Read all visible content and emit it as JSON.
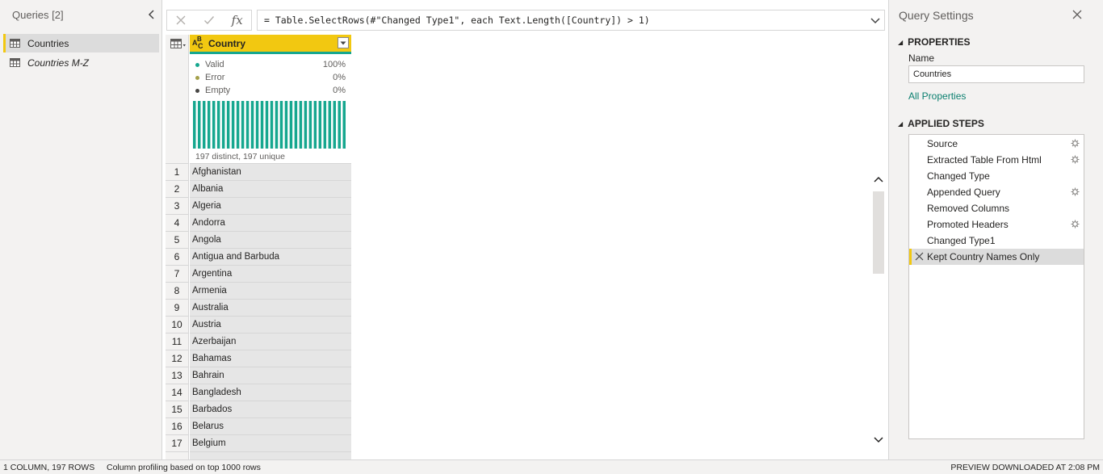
{
  "queries": {
    "header": "Queries [2]",
    "items": [
      {
        "label": "Countries",
        "active": true
      },
      {
        "label": "Countries M-Z",
        "active": false
      }
    ]
  },
  "formula": {
    "text": "= Table.SelectRows(#\"Changed Type1\", each Text.Length([Country]) > 1)",
    "fx_label": "fx"
  },
  "grid": {
    "column": {
      "name": "Country",
      "type_icon": "abc-text-type-icon"
    },
    "profile": {
      "valid_label": "Valid",
      "valid_value": "100%",
      "error_label": "Error",
      "error_value": "0%",
      "empty_label": "Empty",
      "empty_value": "0%",
      "distinct_text": "197 distinct, 197 unique",
      "valid_fraction": 1.0,
      "colors": {
        "valid": "#16a78f",
        "error": "#a4a04a",
        "empty": "#484644"
      }
    },
    "rows": [
      {
        "num": "1",
        "value": "Afghanistan"
      },
      {
        "num": "2",
        "value": "Albania"
      },
      {
        "num": "3",
        "value": "Algeria"
      },
      {
        "num": "4",
        "value": "Andorra"
      },
      {
        "num": "5",
        "value": "Angola"
      },
      {
        "num": "6",
        "value": "Antigua and Barbuda"
      },
      {
        "num": "7",
        "value": "Argentina"
      },
      {
        "num": "8",
        "value": "Armenia"
      },
      {
        "num": "9",
        "value": "Australia"
      },
      {
        "num": "10",
        "value": "Austria"
      },
      {
        "num": "11",
        "value": "Azerbaijan"
      },
      {
        "num": "12",
        "value": "Bahamas"
      },
      {
        "num": "13",
        "value": "Bahrain"
      },
      {
        "num": "14",
        "value": "Bangladesh"
      },
      {
        "num": "15",
        "value": "Barbados"
      },
      {
        "num": "16",
        "value": "Belarus"
      },
      {
        "num": "17",
        "value": "Belgium"
      }
    ]
  },
  "settings": {
    "title": "Query Settings",
    "properties_head": "PROPERTIES",
    "name_label": "Name",
    "name_value": "Countries",
    "all_properties": "All Properties",
    "steps_head": "APPLIED STEPS",
    "steps": [
      {
        "label": "Source",
        "gear": true,
        "active": false
      },
      {
        "label": "Extracted Table From Html",
        "gear": true,
        "active": false
      },
      {
        "label": "Changed Type",
        "gear": false,
        "active": false
      },
      {
        "label": "Appended Query",
        "gear": true,
        "active": false
      },
      {
        "label": "Removed Columns",
        "gear": false,
        "active": false
      },
      {
        "label": "Promoted Headers",
        "gear": true,
        "active": false
      },
      {
        "label": "Changed Type1",
        "gear": false,
        "active": false
      },
      {
        "label": "Kept Country Names Only",
        "gear": false,
        "active": true
      }
    ]
  },
  "status": {
    "left": "1 COLUMN, 197 ROWS",
    "profile": "Column profiling based on top 1000 rows",
    "right": "PREVIEW DOWNLOADED AT 2:08 PM"
  },
  "colors": {
    "accent": "#f2c811",
    "valid": "#16a78f",
    "link": "#0a7f6f"
  }
}
